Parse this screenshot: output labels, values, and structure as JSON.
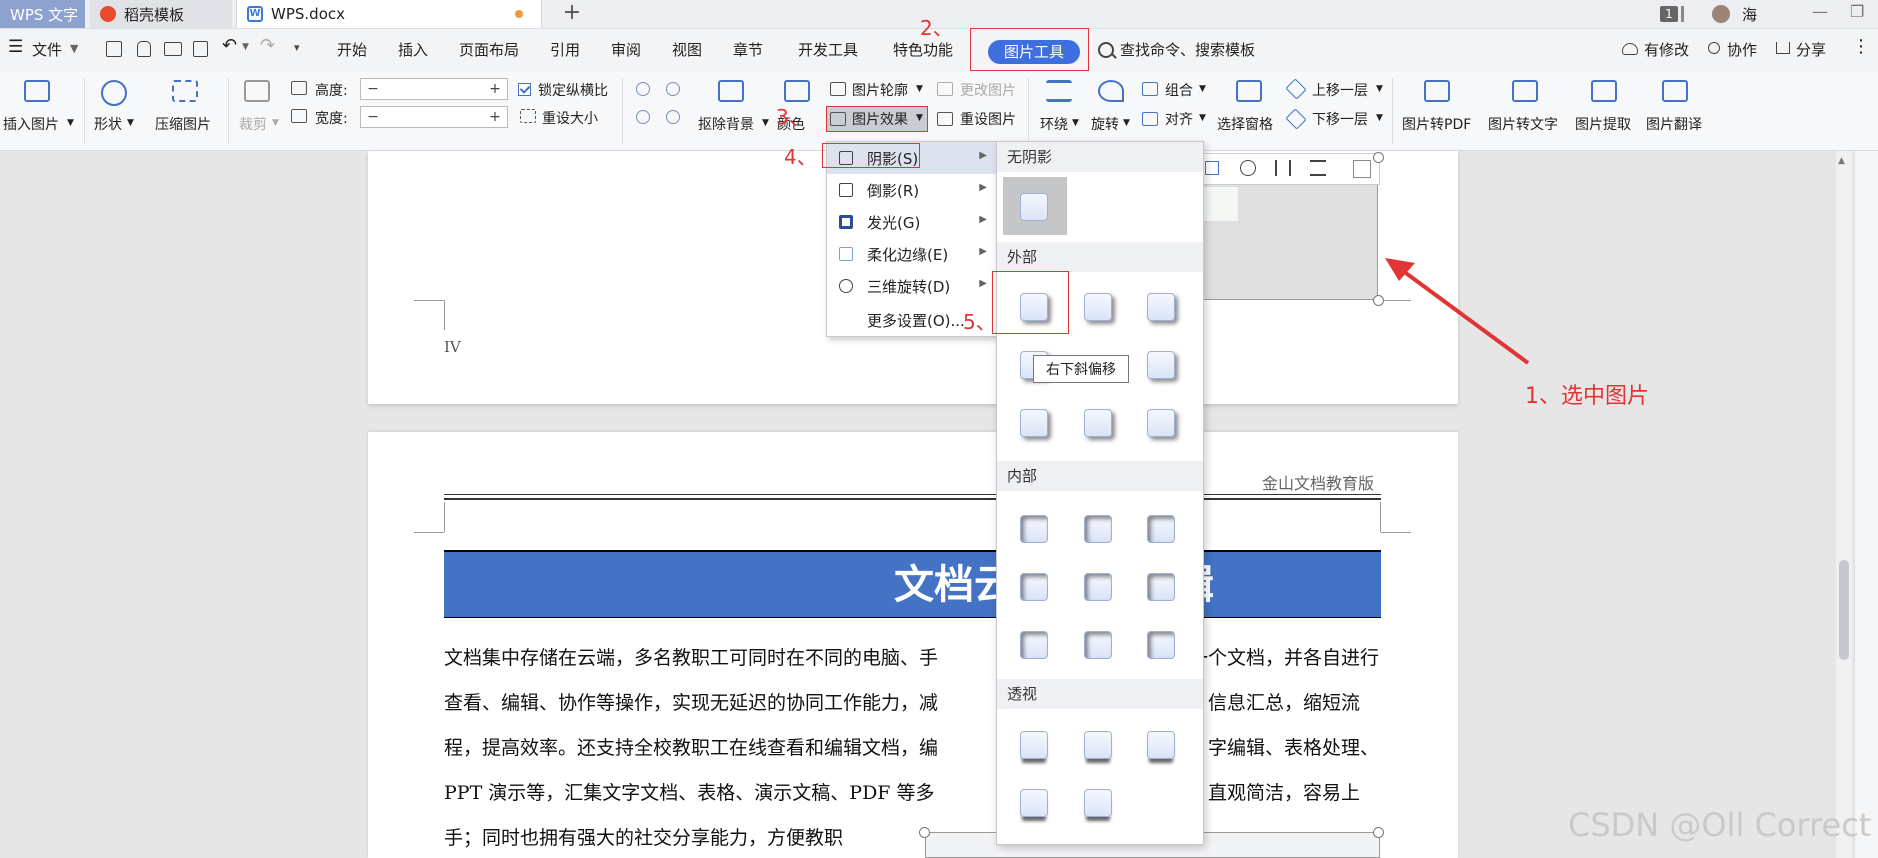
{
  "titlebar": {
    "app_tab": "WPS 文字",
    "template_tab": "稻壳模板",
    "doc_tab": "WPS.docx",
    "new_tab": "+",
    "page_badge": "1",
    "user": "海",
    "doc_icon": "W"
  },
  "menubar": {
    "file": "文件",
    "items": [
      "开始",
      "插入",
      "页面布局",
      "引用",
      "审阅",
      "视图",
      "章节",
      "开发工具",
      "特色功能",
      "图片工具"
    ],
    "search": "查找命令、搜索模板",
    "right": [
      "有修改",
      "协作",
      "分享"
    ]
  },
  "ribbon": {
    "insert_picture": "插入图片",
    "shape": "形状",
    "compress": "压缩图片",
    "crop": "裁剪",
    "height_label": "高度:",
    "width_label": "宽度:",
    "lock_ratio": "锁定纵横比",
    "reset_size": "重设大小",
    "remove_bg": "抠除背景",
    "color": "颜色",
    "outline": "图片轮廓",
    "change_pic": "更改图片",
    "effects": "图片效果",
    "reset_pic": "重设图片",
    "wrap": "环绕",
    "rotate": "旋转",
    "group": "组合",
    "align": "对齐",
    "select_pane": "选择窗格",
    "bring_forward": "上移一层",
    "send_backward": "下移一层",
    "to_pdf": "图片转PDF",
    "to_text": "图片转文字",
    "extract": "图片提取",
    "translate": "图片翻译"
  },
  "document": {
    "page_number": "IV",
    "header": "金山文档教育版",
    "title": "文档云端协作编辑",
    "lines_left": [
      "文档集中存储在云端，多名教职工可同时在不同的电脑、手",
      "查看、编辑、协作等操作，实现无延迟的协同工作能力，减",
      "程，提高效率。还支持全校教职工在线查看和编辑文档，编",
      "PPT 演示等，汇集文字文档、表格、演示文稿、PDF 等多",
      "手；同时也拥有强大的社交分享能力，方便教职"
    ],
    "lines_right": [
      "一个文档，并各自进行",
      "信息汇总，缩短流",
      "字编辑、表格处理、",
      "直观简洁，容易上"
    ]
  },
  "effects_menu": {
    "items": [
      {
        "label": "阴影(S)",
        "has_sub": true
      },
      {
        "label": "倒影(R)",
        "has_sub": true
      },
      {
        "label": "发光(G)",
        "has_sub": true
      },
      {
        "label": "柔化边缘(E)",
        "has_sub": true
      },
      {
        "label": "三维旋转(D)",
        "has_sub": true
      },
      {
        "label": "更多设置(O)...",
        "has_sub": false
      }
    ]
  },
  "shadow_submenu": {
    "no_shadow": "无阴影",
    "outer": "外部",
    "inner": "内部",
    "perspective": "透视",
    "tooltip": "右下斜偏移"
  },
  "annotations": {
    "step1": "1、选中图片",
    "step2": "2、",
    "step3": "3、",
    "step4": "4、",
    "step5": "5、"
  },
  "watermark": "CSDN @Oll Correct",
  "colors": {
    "accent": "#3d6fde",
    "annotation": "#e23434",
    "title_band": "#4472c4"
  }
}
